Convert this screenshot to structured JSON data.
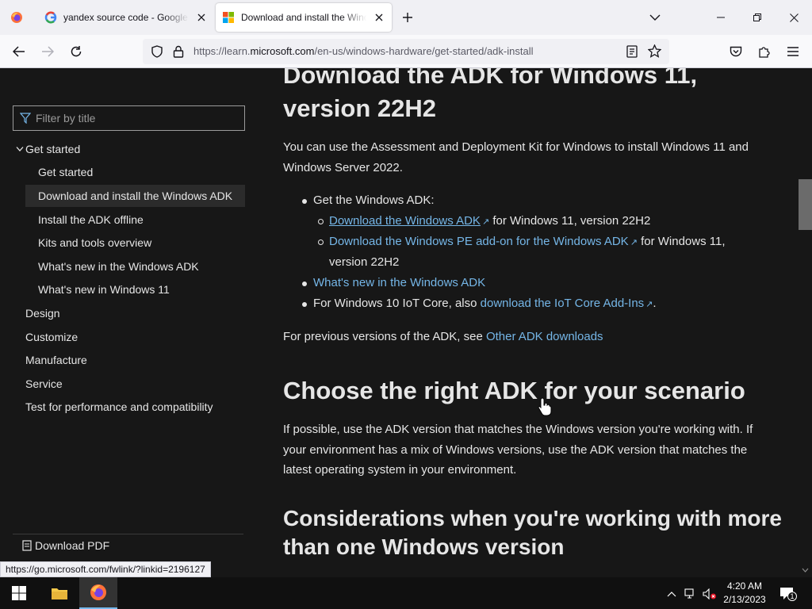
{
  "browser": {
    "tabs": [
      {
        "title": "yandex source code - Google Se",
        "active": false,
        "favicon": "google-g-icon"
      },
      {
        "title": "Download and install the Windo",
        "active": true,
        "favicon": "microsoft-logo-icon"
      }
    ],
    "url_prefix": "https://learn.",
    "url_domain": "microsoft.com",
    "url_path": "/en-us/windows-hardware/get-started/adk-install"
  },
  "sidebar": {
    "filter_placeholder": "Filter by title",
    "items": [
      {
        "label": "Get started"
      },
      {
        "label": "Get started"
      },
      {
        "label": "Download and install the Windows ADK"
      },
      {
        "label": "Install the ADK offline"
      },
      {
        "label": "Kits and tools overview"
      },
      {
        "label": "What's new in the Windows ADK"
      },
      {
        "label": "What's new in Windows 11"
      },
      {
        "label": "Design"
      },
      {
        "label": "Customize"
      },
      {
        "label": "Manufacture"
      },
      {
        "label": "Service"
      },
      {
        "label": "Test for performance and compatibility"
      }
    ],
    "download_pdf": "Download PDF"
  },
  "content": {
    "h1_line1": "Download the ADK for Windows 11,",
    "h1_line2": "version 22H2",
    "intro_line1": "You can use the Assessment and Deployment Kit for Windows to install Windows 11 and",
    "intro_line2": "Windows Server 2022.",
    "bullet1": "Get the Windows ADK:",
    "sub1_link": "Download the Windows ADK",
    "sub1_rest": " for Windows 11, version 22H2",
    "sub2_link": "Download the Windows PE add-on for the Windows ADK",
    "sub2_rest": " for Windows 11,",
    "sub2_line2": "version 22H2",
    "bullet2_link": "What's new in the Windows ADK",
    "bullet3_text": "For Windows 10 IoT Core, also ",
    "bullet3_link": "download the IoT Core Add-Ins",
    "bullet3_end": ".",
    "prev_text": "For previous versions of the ADK, see ",
    "prev_link": "Other ADK downloads",
    "h2": "Choose the right ADK for your scenario",
    "p2_line1": "If possible, use the ADK version that matches the Windows version you're working with. If",
    "p2_line2": "your environment has a mix of Windows versions, use the ADK version that matches the",
    "p2_line3": "latest operating system in your environment.",
    "h3_line1": "Considerations when you're working with more",
    "h3_line2": "than one Windows version"
  },
  "status_link": "https://go.microsoft.com/fwlink/?linkid=2196127",
  "taskbar": {
    "time": "4:20 AM",
    "date": "2/13/2023",
    "notification_count": "1"
  },
  "colors": {
    "page_bg": "#171717",
    "link": "#75b6e7",
    "text": "#e6e6e6",
    "taskbar": "#101010"
  }
}
